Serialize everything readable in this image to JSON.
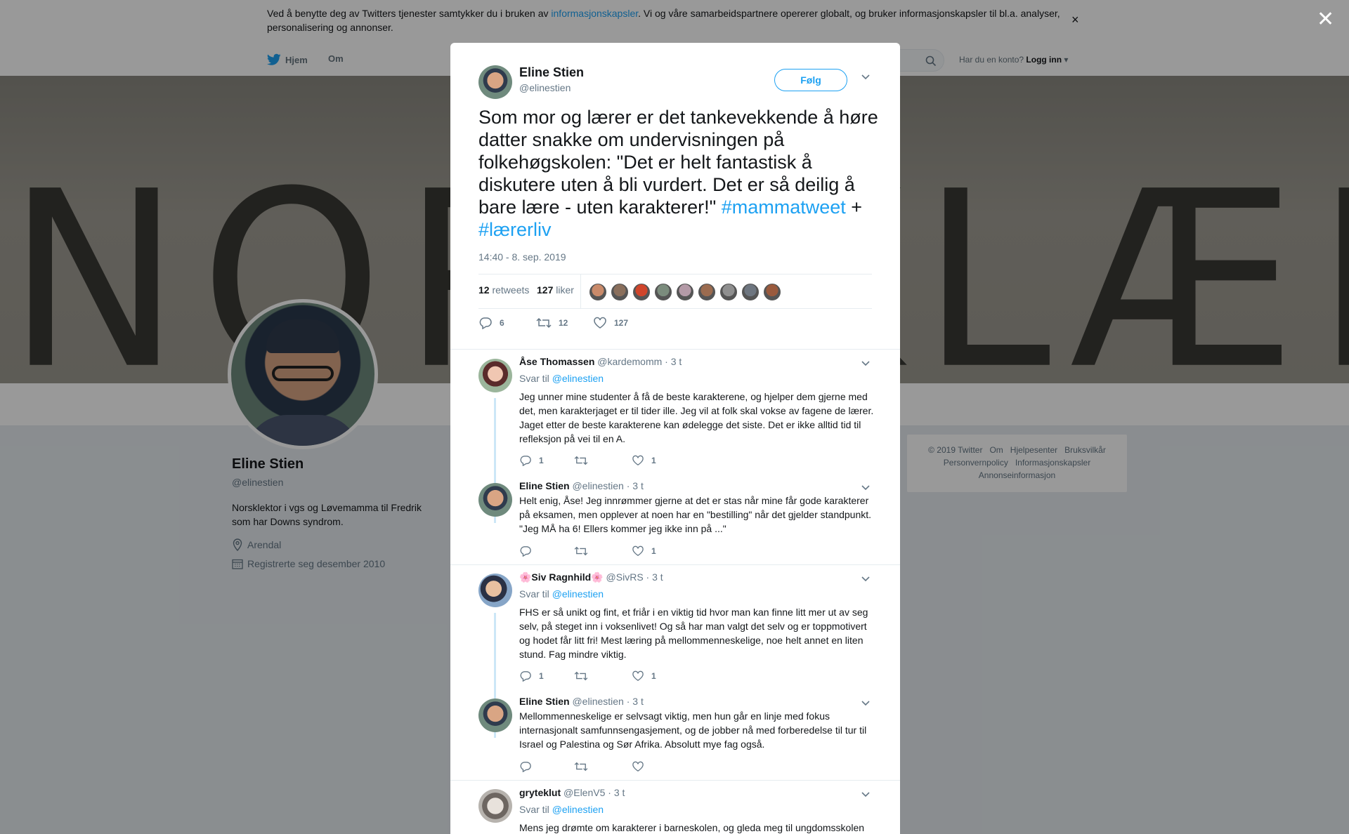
{
  "cookie": {
    "text_before": "Ved å benytte deg av Twitters tjenester samtykker du i bruken av ",
    "link": "informasjonskapsler",
    "text_after": ". Vi og våre samarbeidspartnere opererer globalt, og bruker informasjonskapsler til bl.a. analyser, personalisering og annonser.",
    "close": "×"
  },
  "nav": {
    "home": "Hjem",
    "about": "Om",
    "login_prompt": "Har du en konto?",
    "login": "Logg inn"
  },
  "banner": {
    "text": "NORSKLÆREREN"
  },
  "profile": {
    "name": "Eline Stien",
    "handle": "@elinestien",
    "bio": "Norsklektor i vgs og Løvemamma til Fredrik som har Downs syndrom.",
    "location": "Arendal",
    "joined": "Registrerte seg desember 2010"
  },
  "footer": {
    "links_row1": [
      "© 2019 Twitter",
      "Om",
      "Hjelpesenter",
      "Bruksvilkår"
    ],
    "links_row2": [
      "Personvernpolicy",
      "Informasjonskapsler"
    ],
    "links_row3": [
      "Annonseinformasjon"
    ]
  },
  "overlay": {
    "close": "✕"
  },
  "tweet": {
    "name": "Eline Stien",
    "handle": "@elinestien",
    "follow": "Følg",
    "text_main": "Som mor og lærer er det tankevekkende å høre datter snakke om undervisningen på folkehøgskolen: \"Det er helt fantastisk å diskutere  uten å bli vurdert. Det er så deilig å bare lære - uten karakterer!\" ",
    "hashtag1": "#mammatweet",
    "plus": " + ",
    "hashtag2": "#lærerliv",
    "time": "14:40 - 8. sep. 2019",
    "retweets_count": "12",
    "retweets_label": "retweets",
    "likes_count": "127",
    "likes_label": "liker",
    "actions": {
      "replies": "6",
      "retweets": "12",
      "likes": "127"
    },
    "liker_colors": [
      "#c98a6a",
      "#8a6f5c",
      "#d0452b",
      "#7b8c7d",
      "#b49aa7",
      "#9b6b4f",
      "#8f8f8f",
      "#6e7680",
      "#9a5a3d"
    ]
  },
  "replies": [
    {
      "name": "Åse Thomassen",
      "handle": "@kardemomm",
      "time": "· 3 t",
      "reply_to_label": "Svar til",
      "reply_to": "@elinestien",
      "text": "Jeg unner mine studenter å få de beste karakterene, og hjelper dem gjerne med det, men karakterjaget er til tider ille. Jeg vil at folk skal vokse av fagene de lærer. Jaget etter de beste karakterene kan ødelegge det siste. Det er ikke alltid tid til refleksjon på vei til en A.",
      "replies": "1",
      "retweets": "",
      "likes": "1"
    },
    {
      "name": "Eline Stien",
      "handle": "@elinestien",
      "time": "· 3 t",
      "text": "Helt enig, Åse! Jeg innrømmer gjerne at det er stas når mine får gode karakterer på eksamen, men opplever at noen har en \"bestilling\" når det gjelder standpunkt. \"Jeg MÅ ha 6! Ellers kommer jeg ikke inn på ...\"",
      "replies": "",
      "retweets": "",
      "likes": "1"
    },
    {
      "name": "🌸Siv Ragnhild🌸",
      "handle": "@SivRS",
      "time": "· 3 t",
      "reply_to_label": "Svar til",
      "reply_to": "@elinestien",
      "text": "FHS er så unikt og fint, et friår i en viktig tid hvor man kan finne litt mer ut av seg selv, på steget inn i voksenlivet! Og så har man valgt det selv og er toppmotivert og hodet får litt fri! Mest læring på  mellommenneskelige, noe helt annet en liten stund. Fag mindre viktig.",
      "replies": "1",
      "retweets": "",
      "likes": "1"
    },
    {
      "name": "Eline Stien",
      "handle": "@elinestien",
      "time": "· 3 t",
      "text": "Mellommenneskelige er selvsagt viktig, men hun går en linje med fokus internasjonalt samfunnsengasjement, og de jobber nå med forberedelse til tur til Israel og Palestina og Sør Afrika. Absolutt mye fag også.",
      "replies": "",
      "retweets": "",
      "likes": ""
    },
    {
      "name": "gryteklut",
      "handle": "@ElenV5",
      "time": "· 3 t",
      "reply_to_label": "Svar til",
      "reply_to": "@elinestien",
      "text": "Mens jeg drømte om karakterer i barneskolen, og gleda meg til ungdomsskolen"
    }
  ]
}
